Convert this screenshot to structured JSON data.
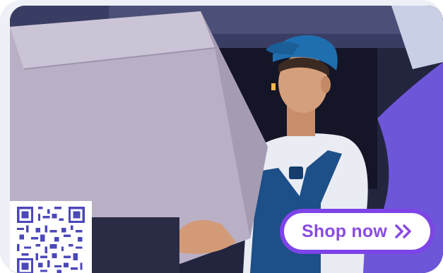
{
  "cta": {
    "label": "Shop now",
    "icon": "double-chevron-right-icon"
  },
  "colors": {
    "accent": "#7d44e8",
    "accent_text": "#8a4be2",
    "frame": "#eef0f7",
    "dark": "#1d1f3f"
  },
  "qr": {
    "icon": "qr-code-icon"
  },
  "photo": {
    "icon": "delivery-man-photo"
  }
}
